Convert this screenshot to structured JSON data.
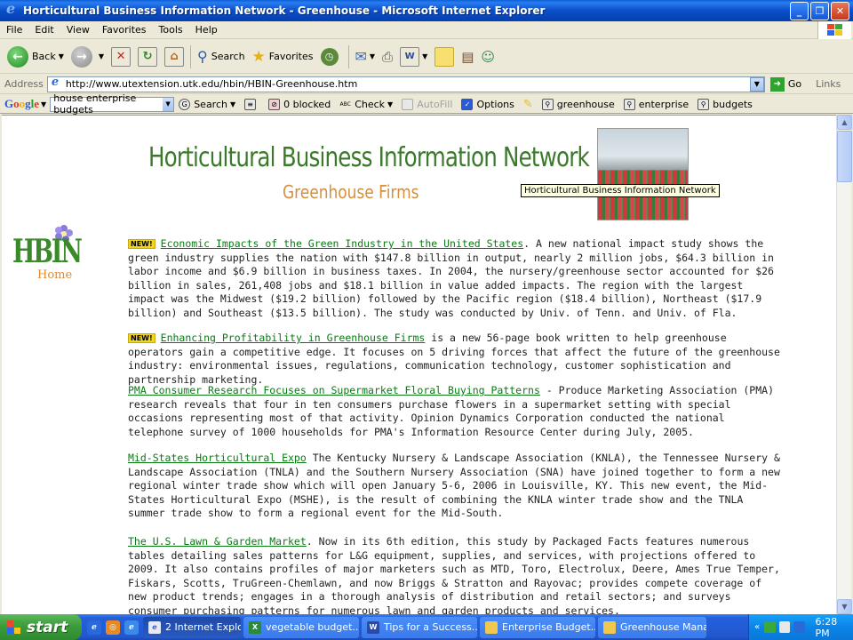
{
  "window": {
    "title": "Horticultural Business Information Network - Greenhouse - Microsoft Internet Explorer"
  },
  "menu": [
    "File",
    "Edit",
    "View",
    "Favorites",
    "Tools",
    "Help"
  ],
  "toolbar": {
    "back_label": "Back",
    "search_label": "Search",
    "favorites_label": "Favorites"
  },
  "address": {
    "label": "Address",
    "url": "http://www.utextension.utk.edu/hbin/HBIN-Greenhouse.htm",
    "go_label": "Go",
    "links_label": "Links"
  },
  "googlebar": {
    "logo": "Google",
    "query": "house enterprise budgets",
    "search_label": "Search",
    "blocked_label": "0 blocked",
    "check_label": "Check",
    "autofill_label": "AutoFill",
    "options_label": "Options",
    "terms": [
      "greenhouse",
      "enterprise",
      "budgets"
    ]
  },
  "page": {
    "banner_title": "Horticultural Business Information Network",
    "banner_subtitle": "Greenhouse Firms",
    "tooltip": "Horticultural Business Information Network",
    "logo_text": "HBIN",
    "logo_sub": "Home",
    "new_badge": "NEW!",
    "articles": [
      {
        "new": true,
        "link": "Economic Impacts of the Green Industry in the United States",
        "text": ". A new national impact study shows the green industry supplies the nation with $147.8 billion in output, nearly 2 million jobs, $64.3 billion in labor income and $6.9 billion in business taxes. In 2004, the nursery/greenhouse sector accounted for $26 billion in sales, 261,408 jobs and $18.1 billion in value added impacts. The region with the largest impact was the Midwest ($19.2 billion) followed by the Pacific region ($18.4 billion), Northeast ($17.9 billion) and Southeast ($13.5 billion). The study was conducted by Univ. of Tenn. and Univ. of Fla."
      },
      {
        "new": true,
        "link": "Enhancing Profitability in Greenhouse Firms",
        "text": " is a new 56-page book written to help greenhouse operators gain a competitive edge. It focuses on 5 driving forces that affect the future of the greenhouse industry: environmental issues, regulations, communication technology, customer sophistication and partnership marketing."
      },
      {
        "new": false,
        "link": "PMA Consumer Research Focuses on Supermarket Floral Buying Patterns",
        "text": " - Produce Marketing Association (PMA) research reveals that four in ten consumers purchase flowers in a supermarket setting with special occasions representing most of that activity. Opinion Dynamics Corporation conducted the national telephone survey of 1000 households for PMA's Information Resource Center during July, 2005."
      },
      {
        "new": false,
        "link": "Mid-States Horticultural Expo",
        "text": " The Kentucky Nursery & Landscape Association (KNLA), the Tennessee Nursery & Landscape Association (TNLA) and the Southern Nursery Association (SNA) have joined together to form a new regional winter trade show which will open January 5-6, 2006 in Louisville, KY. This new event, the Mid-States Horticultural Expo (MSHE), is the result of combining the KNLA winter trade show and the TNLA summer trade show to form a regional event for the Mid-South."
      },
      {
        "new": false,
        "link": "The U.S. Lawn & Garden Market",
        "text": ". Now in its 6th edition, this study by Packaged Facts features numerous tables detailing sales patterns for L&G equipment, supplies, and services, with projections offered to 2009. It also contains profiles of major marketers such as MTD, Toro, Electrolux, Deere, Ames True Temper, Fiskars, Scotts, TruGreen-Chemlawn, and now Briggs & Stratton and Rayovac; provides compete coverage of new product trends; engages in a thorough analysis of distribution and retail sectors; and surveys consumer purchasing patterns for numerous lawn and garden products and services."
      }
    ]
  },
  "taskbar": {
    "start_label": "start",
    "tasks": [
      "2 Internet Explo...",
      "vegetable budget...",
      "Tips for a Success...",
      "Enterprise Budget...",
      "Greenhouse Mana..."
    ],
    "clock": "6:28 PM"
  },
  "colors": {
    "link": "#0a7a14",
    "title_green": "#3a7a2a",
    "subtitle_orange": "#d49040",
    "badge_yellow": "#f2d61a"
  }
}
